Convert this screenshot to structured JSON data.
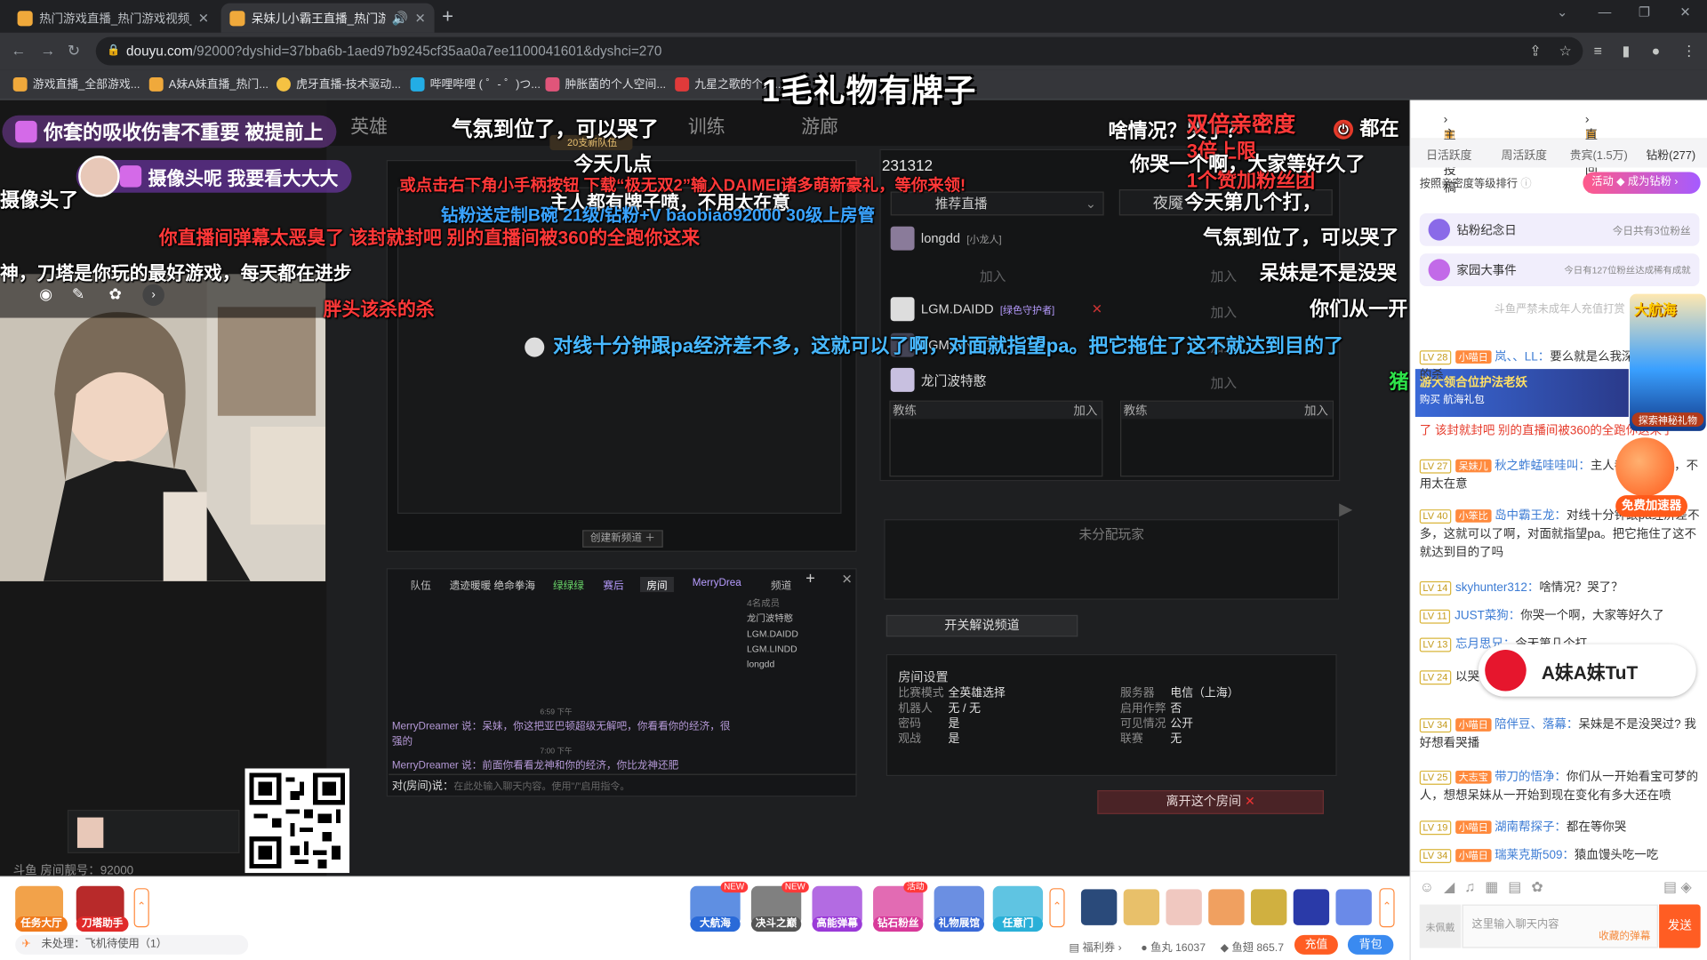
{
  "browser": {
    "tabs": [
      {
        "title": "热门游戏直播_热门游戏视频_热"
      },
      {
        "title": "呆妹儿小霸王直播_热门游戏"
      }
    ],
    "url_host": "douyu.com",
    "url_rest": "/92000?dyshid=37bba6b-1aed97b9245cf35aa0a7ee1100041601&dyshci=270",
    "bookmarks": [
      "游戏直播_全部游戏...",
      "A妹A妹直播_热门...",
      "虎牙直播-技术驱动...",
      "哔哩哔哩 ( ゜- ゜)つ...",
      "肿胀菌的个人空间...",
      "九星之歌的个人..."
    ]
  },
  "overlay_title": "1毛礼物有牌子",
  "video": {
    "nav": [
      "英雄",
      "训练",
      "游廊"
    ],
    "lobby_title": "231312",
    "team_tab": "推荐直播",
    "players": [
      {
        "name": "longdd",
        "tag": "[小龙人]"
      },
      {
        "name": "LGM.DAIDD",
        "tag": "[绿色守护者]"
      },
      {
        "name": "LGM.LINDD",
        "tag": ""
      },
      {
        "name": "龙门波特憨",
        "tag": ""
      }
    ],
    "join_label": "加入",
    "coach_label": "教练",
    "unassigned": "未分配玩家",
    "commentary_btn": "开关解说频道",
    "create_channel": "创建新频道 ＋",
    "leave_room": "离开这个房间",
    "room_settings_title": "房间设置",
    "room_settings": [
      {
        "k": "比赛模式",
        "v": "全英雄选择"
      },
      {
        "k": "机器人",
        "v": "无 / 无"
      },
      {
        "k": "密码",
        "v": "是"
      },
      {
        "k": "观战",
        "v": "是"
      }
    ],
    "room_settings_right": [
      {
        "k": "服务器",
        "v": "电信（上海）"
      },
      {
        "k": "启用作弊",
        "v": "否"
      },
      {
        "k": "可见情况",
        "v": "公开"
      },
      {
        "k": "联赛",
        "v": "无"
      }
    ],
    "chat_tabs": [
      "队伍",
      "遗迹暖暖 绝命拳海",
      "绿绿绿",
      "赛后",
      "房间",
      "MerryDrea",
      "频道"
    ],
    "chat_members": [
      "4名成员",
      "龙门波特憨",
      "LGM.DAIDD",
      "LGM.LINDD",
      "longdd"
    ],
    "chat_lines": [
      "MerryDreamer 说：呆妹，你这把亚巴顿超级无解吧，你看看你的经济，很强的",
      "MerryDreamer 说：前面你看看龙神和你的经济，你比龙神还肥"
    ],
    "chat_prompt": "对(房间)说：",
    "chat_placeholder": "在此处输入聊天内容。使用\"/\"启用指令。",
    "room_number": "斗鱼 房间靓号：92000",
    "hot_team": "20支新队伍",
    "chat_times": [
      "6:59 下午",
      "7:00 下午"
    ],
    "opponent_name": "夜魇"
  },
  "danmaku": [
    {
      "text": "你套的吸收伤害不重要 被提前上",
      "color": "w"
    },
    {
      "text": "摄像头呢 我要看大大大",
      "color": "w"
    },
    {
      "text": "气氛到位了，可以哭了",
      "color": "w"
    },
    {
      "text": "今天几点",
      "color": "w"
    },
    {
      "text": "啥情况？哭了？",
      "color": "w"
    },
    {
      "text": "双倍亲密度",
      "color": "r"
    },
    {
      "text": "3倍上限",
      "color": "r"
    },
    {
      "text": "1个赞加粉丝团",
      "color": "r"
    },
    {
      "text": "你哭一个啊，大家等好久了",
      "color": "w"
    },
    {
      "text": "或点击右下角小手柄按钮 下载“极无双2”输入DAIMEI诸多萌新豪礼，等你来领!",
      "color": "r"
    },
    {
      "text": "摄像头了",
      "color": "w"
    },
    {
      "text": "主人都有牌子喷，不用太在意",
      "color": "w"
    },
    {
      "text": "钻粉送定制B碗 21级/钻粉+V baobiao92000 30级上房管",
      "color": "b"
    },
    {
      "text": "今天第几个打，",
      "color": "w"
    },
    {
      "text": "你直播间弹幕太恶臭了 该封就封吧 别的直播间被360的全跑你这来",
      "color": "r"
    },
    {
      "text": "气氛到位了，可以哭了",
      "color": "w"
    },
    {
      "text": "神，刀塔是你玩的最好游戏，每天都在进步",
      "color": "w"
    },
    {
      "text": "呆妹是不是没哭",
      "color": "w"
    },
    {
      "text": "胖头该杀的杀",
      "color": "r"
    },
    {
      "text": "你们从一开",
      "color": "w"
    },
    {
      "text": "对线十分钟跟pa经济差不多，这就可以了啊，对面就指望pa。把它拖住了这不就达到目的了",
      "color": "c"
    },
    {
      "text": "猪",
      "color": "g"
    },
    {
      "text": "都在",
      "color": "w"
    }
  ],
  "sidebar": {
    "top_left": "主播投稿",
    "top_right": "直播回看",
    "tabs": [
      "日活跃度",
      "周活跃度",
      "贵宾(1.5万)",
      "钻粉(277)"
    ],
    "sort_label": "按照亲密度等级排行",
    "fan_btn": "成为钻粉",
    "activity_tag": "活动",
    "card1": {
      "title": "钻粉纪念日",
      "sub": "今日共有3位粉丝"
    },
    "card2": {
      "title": "家园大事件",
      "sub": "今日有127位粉丝达成稀有成就"
    },
    "notice": "斗鱼严禁未成年人充值打赏",
    "messages": [
      {
        "lv": "LV 28",
        "medal": "小喵日",
        "user": "岚、、LL：",
        "text": "要么就是么我深下就当该杀的杀"
      },
      {
        "lv": "",
        "medal": "",
        "user": "",
        "text": "了 该封就封吧 别的直播间被360的全跑你这来了"
      },
      {
        "lv": "LV 27",
        "medal": "呆妹儿",
        "user": "秋之蚱蜢哇哇叫：",
        "text": "主人都有牌子喷，不用太在意"
      },
      {
        "lv": "LV 40",
        "medal": "小笨比",
        "user": "岛中霸王龙：",
        "text": "对线十分钟跟pa经济差不多，这就可以了啊，对面就指望pa。把它拖住了这不就达到目的了吗"
      },
      {
        "lv": "LV 14",
        "medal": "",
        "user": "skyhunter312：",
        "text": "啥情况？哭了？"
      },
      {
        "lv": "LV 11",
        "medal": "",
        "user": "JUST菜狗：",
        "text": "你哭一个啊，大家等好久了"
      },
      {
        "lv": "LV 13",
        "medal": "",
        "user": "忘月思兄：",
        "text": "今天第几个打"
      },
      {
        "lv": "LV 24",
        "medal": "",
        "user": "",
        "text": "以哭了"
      },
      {
        "lv": "LV 34",
        "medal": "小喵日",
        "user": "陪伴豆、落幕：",
        "text": "呆妹是不是没哭过? 我好想看哭播"
      },
      {
        "lv": "LV 25",
        "medal": "大志宝",
        "user": "带刀的悟净：",
        "text": "你们从一开始看宝可梦的人，想想呆妹从一开始到现在变化有多大还在喷"
      },
      {
        "lv": "LV 19",
        "medal": "小喵日",
        "user": "湖南帮探子：",
        "text": "都在等你哭"
      },
      {
        "lv": "LV 34",
        "medal": "小喵日",
        "user": "瑞莱克斯509：",
        "text": "猿血馒头吃一吃"
      }
    ],
    "chat_placeholder": "这里输入聊天内容",
    "chat_hint": "收藏的弹幕",
    "send": "发送",
    "sub_badge": "未佩戴",
    "weibo_name": "A妹A妹TuT",
    "ship_title": "大航海",
    "ship_btn": "探索神秘礼物",
    "accel": "免费加速器",
    "ad_title": "游大领合位护法老妖",
    "ad_sub": "购买 航海礼包"
  },
  "bottom": {
    "left_items": [
      {
        "label": "任务大厅",
        "color": "#f07a1c"
      },
      {
        "label": "刀塔助手",
        "color": "#e02a2a"
      }
    ],
    "mid_items": [
      {
        "label": "大航海",
        "color": "#2a6ad8",
        "badge": "NEW"
      },
      {
        "label": "决斗之巅",
        "color": "#555",
        "badge": "NEW"
      },
      {
        "label": "高能弹幕",
        "color": "#9a3ad8",
        "badge": ""
      },
      {
        "label": "钻石粉丝",
        "color": "#d83a9a",
        "badge": "活动"
      },
      {
        "label": "礼物展馆",
        "color": "#3a6ad8",
        "badge": ""
      },
      {
        "label": "任意门",
        "color": "#2ab0d8",
        "badge": ""
      }
    ],
    "pending": "未处理：飞机待使用（1）",
    "welfare": "福利券",
    "fishball": "鱼丸 16037",
    "fishwing": "鱼翅 865.7",
    "recharge": "充值",
    "bag": "背包"
  }
}
